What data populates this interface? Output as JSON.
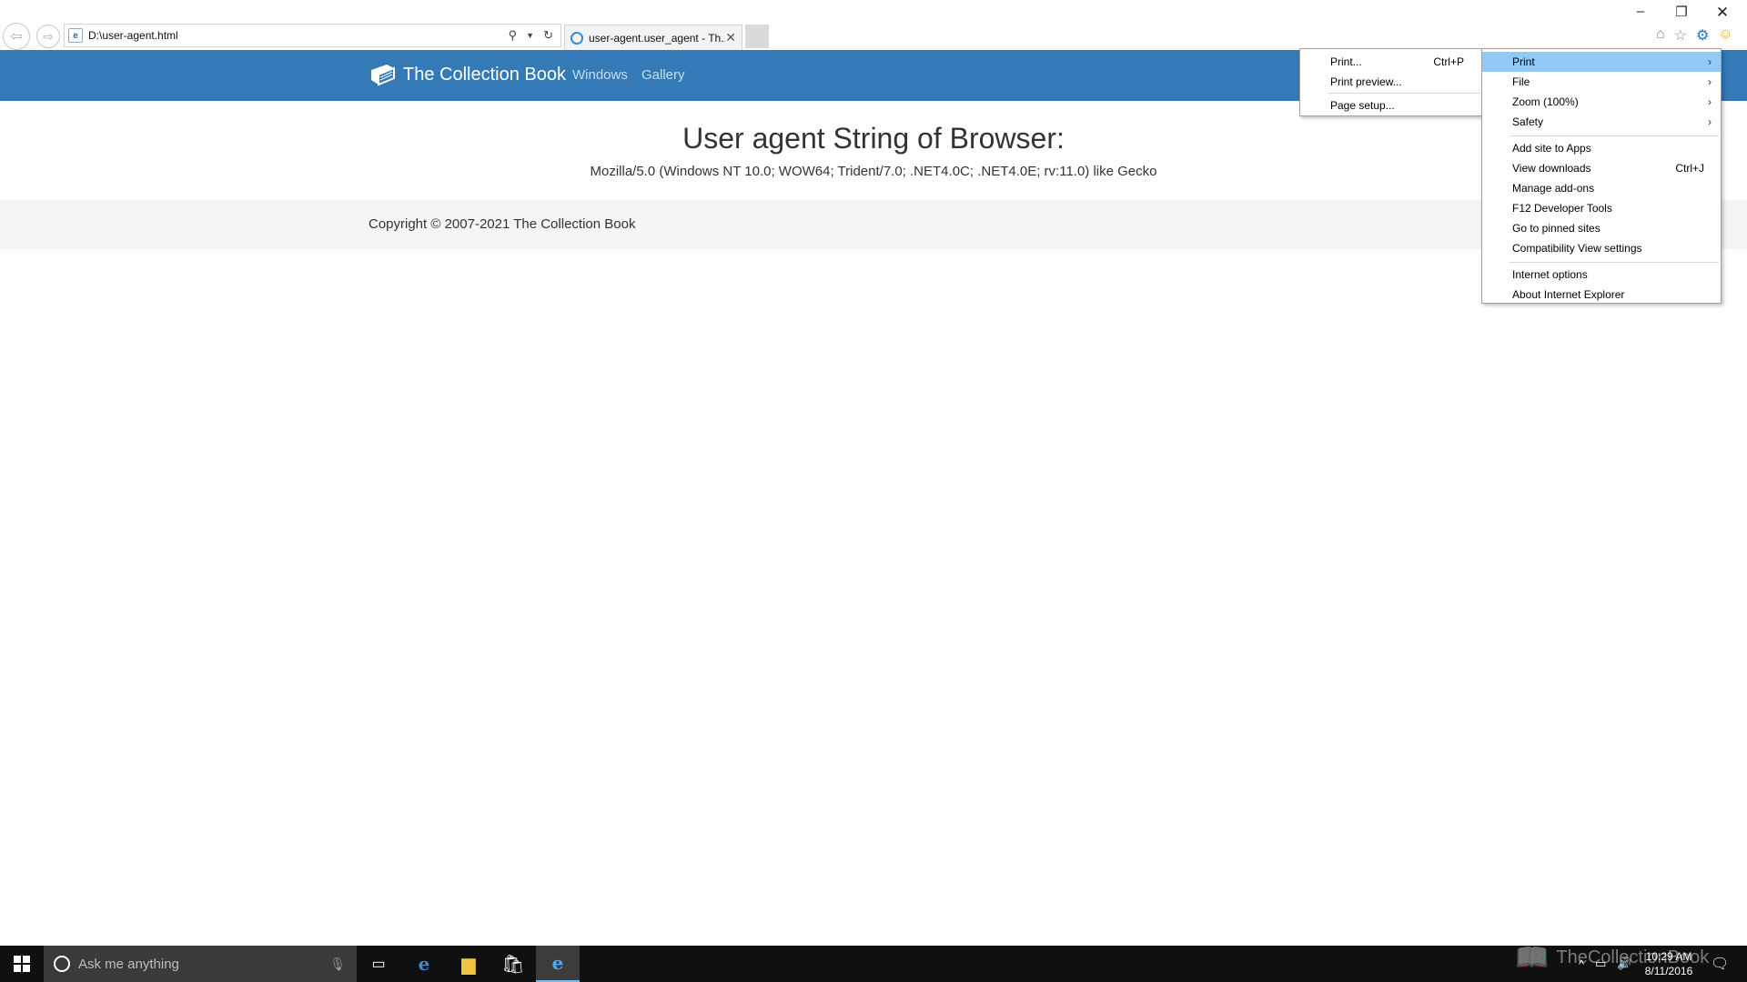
{
  "browser": {
    "address": "D:\\user-agent.html",
    "tab_title": "user-agent.user_agent - Th...",
    "window_controls": {
      "minimize": "–",
      "restore": "❐",
      "close": "✕"
    }
  },
  "site": {
    "brand": "The Collection Book",
    "nav": [
      "Windows",
      "Gallery"
    ],
    "heading": "User agent String of Browser:",
    "ua_string": "Mozilla/5.0 (Windows NT 10.0; WOW64; Trident/7.0; .NET4.0C; .NET4.0E; rv:11.0) like Gecko",
    "copyright": "Copyright © 2007-2021 The Collection Book"
  },
  "print_submenu": {
    "items": [
      {
        "label": "Print...",
        "shortcut": "Ctrl+P"
      },
      {
        "label": "Print preview...",
        "shortcut": ""
      },
      {
        "label": "Page setup...",
        "shortcut": ""
      }
    ]
  },
  "tools_menu": {
    "items": [
      {
        "label": "Print",
        "has_submenu": true,
        "highlighted": true
      },
      {
        "label": "File",
        "has_submenu": true
      },
      {
        "label": "Zoom (100%)",
        "has_submenu": true
      },
      {
        "label": "Safety",
        "has_submenu": true
      },
      {
        "label": "Add site to Apps"
      },
      {
        "label": "View downloads",
        "shortcut": "Ctrl+J"
      },
      {
        "label": "Manage add-ons"
      },
      {
        "label": "F12 Developer Tools"
      },
      {
        "label": "Go to pinned sites"
      },
      {
        "label": "Compatibility View settings"
      },
      {
        "label": "Internet options"
      },
      {
        "label": "About Internet Explorer"
      }
    ]
  },
  "taskbar": {
    "search_placeholder": "Ask me anything",
    "time": "10:29 AM",
    "date": "8/11/2016",
    "watermark": "TheCollectionBook"
  },
  "colors": {
    "navbar": "#337ab7",
    "menu_highlight": "#91c9f7",
    "taskbar": "#101010"
  },
  "icons": [
    "back-arrow-icon",
    "forward-arrow-icon",
    "search-icon",
    "refresh-icon",
    "home-icon",
    "star-icon",
    "gear-icon",
    "smile-icon",
    "windows-logo-icon",
    "cortana-icon",
    "microphone-icon",
    "task-view-icon",
    "edge-icon",
    "file-explorer-icon",
    "store-icon",
    "internet-explorer-icon",
    "notification-icon"
  ]
}
